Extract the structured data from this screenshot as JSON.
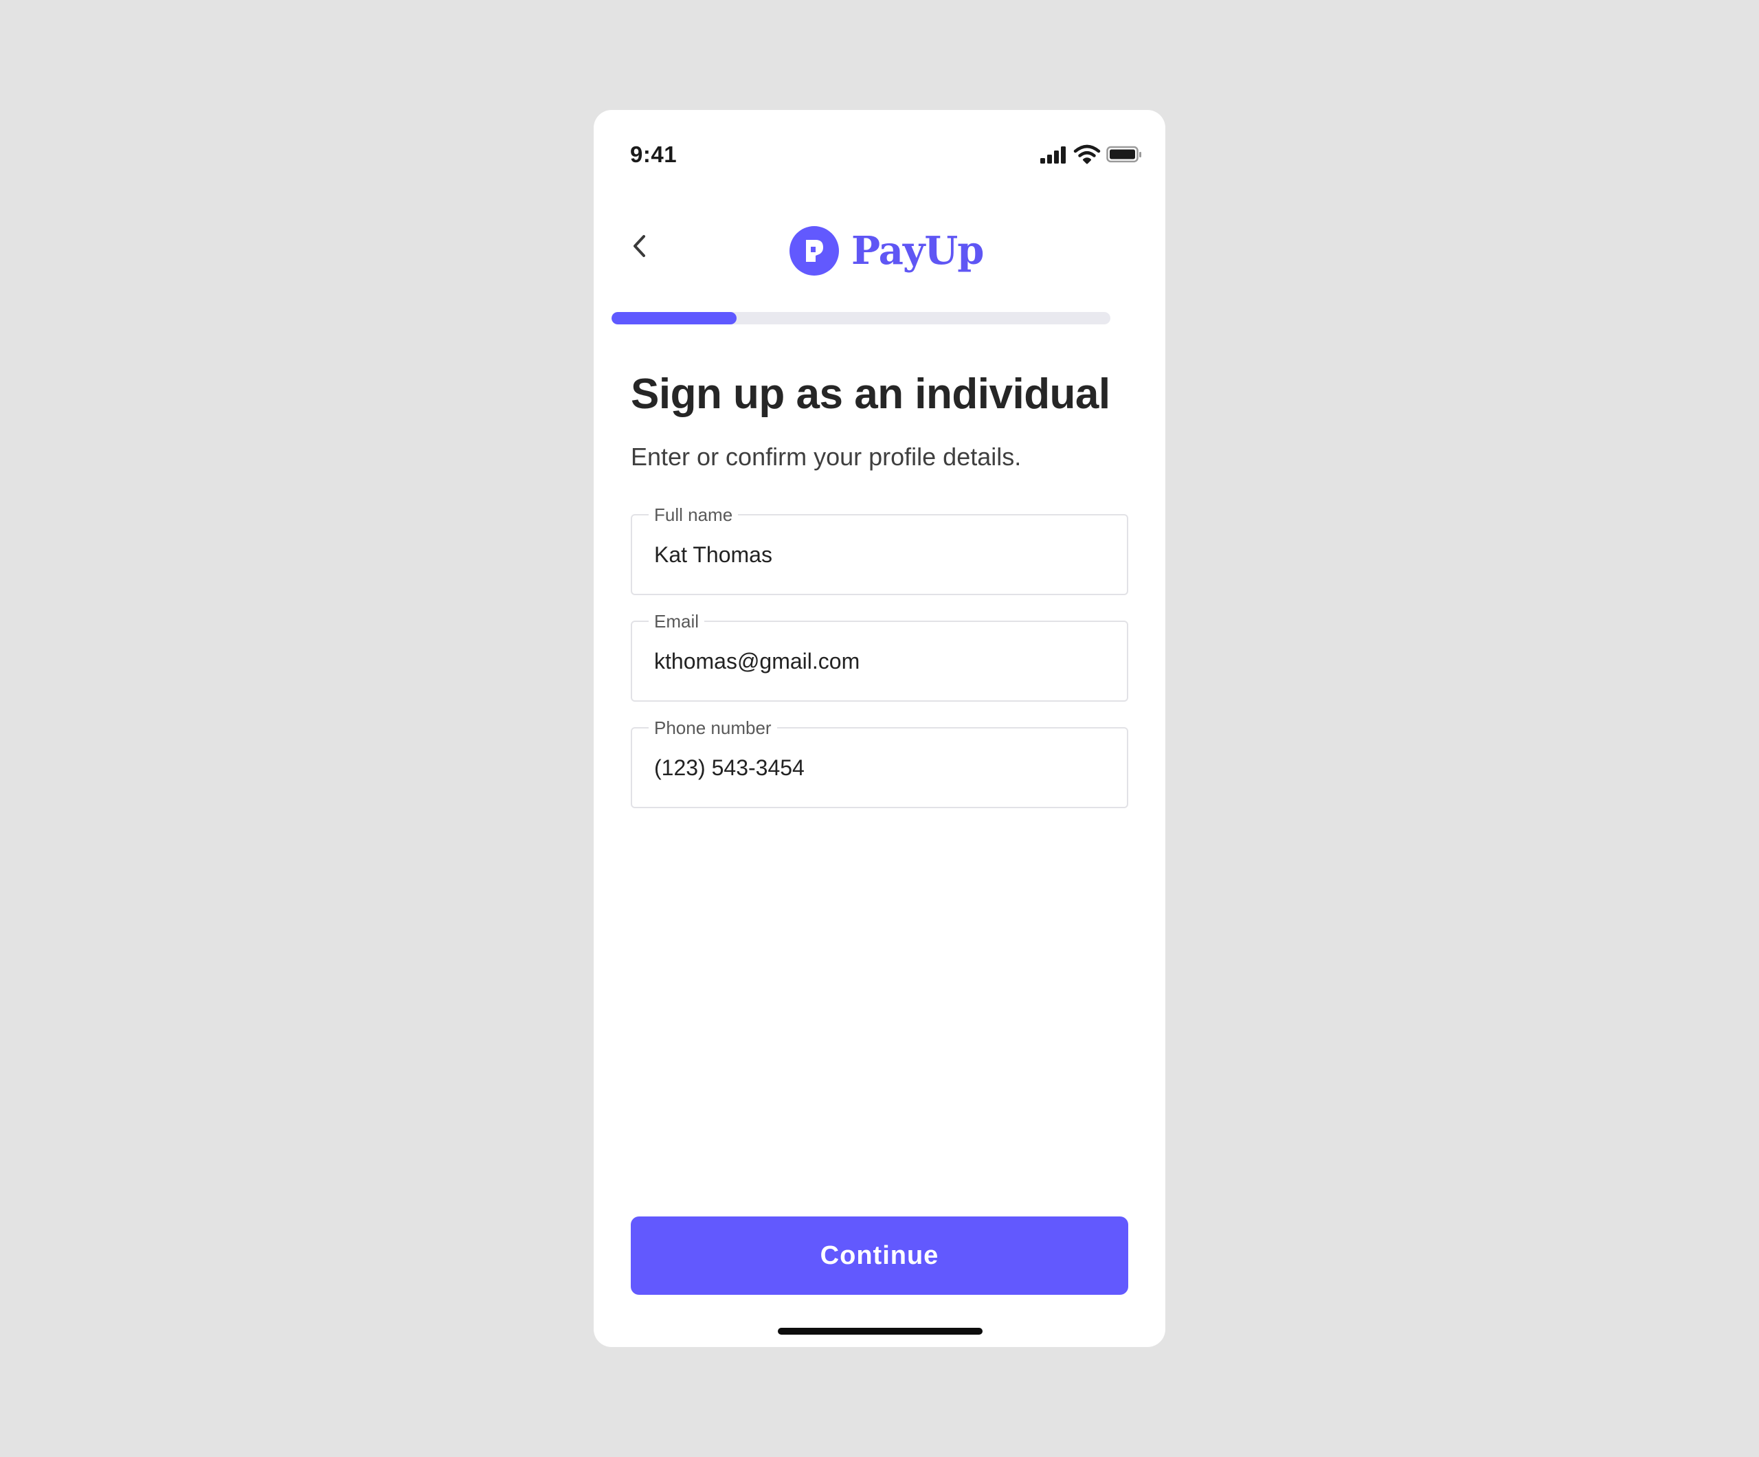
{
  "status_bar": {
    "time": "9:41",
    "icons": [
      "signal-icon",
      "wifi-icon",
      "battery-icon"
    ]
  },
  "header": {
    "back_icon": "chevron-left-icon",
    "logo_icon": "payup-logo-icon",
    "brand_name": "PayUp"
  },
  "progress": {
    "fraction": 0.25
  },
  "page": {
    "title": "Sign up as an individual",
    "subtitle": "Enter or confirm your profile details."
  },
  "form": {
    "full_name": {
      "label": "Full name",
      "value": "Kat Thomas"
    },
    "email": {
      "label": "Email",
      "value": "kthomas@gmail.com"
    },
    "phone": {
      "label": "Phone number",
      "value": "(123) 543-3454"
    }
  },
  "actions": {
    "continue_label": "Continue"
  },
  "colors": {
    "accent": "#6259fe",
    "brand_text": "#5f56f4",
    "background": "#e3e3e3",
    "progress_track": "#e9e9ef"
  }
}
